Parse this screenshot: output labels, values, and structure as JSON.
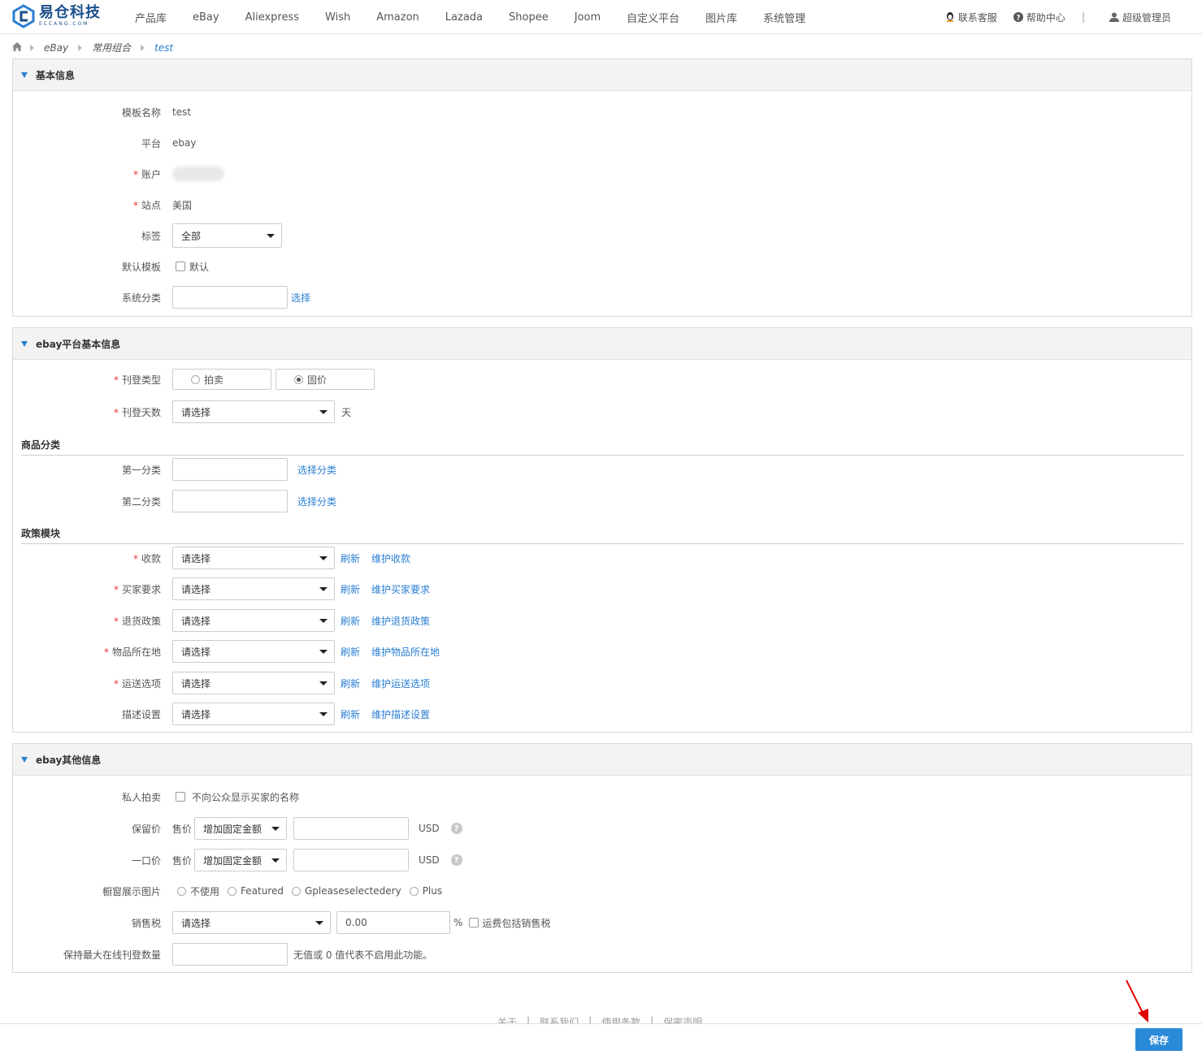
{
  "brand": {
    "name_cn": "易仓科技",
    "name_en": "ECCANG.COM",
    "color": "#1b4f8a"
  },
  "nav": [
    "产品库",
    "eBay",
    "Aliexpress",
    "Wish",
    "Amazon",
    "Lazada",
    "Shopee",
    "Joom",
    "自定义平台",
    "图片库",
    "系统管理"
  ],
  "nav_right": {
    "service": "联系客服",
    "help": "帮助中心",
    "sep": "|",
    "user": "超级管理员"
  },
  "breadcrumb": [
    "eBay",
    "常用组合",
    "test"
  ],
  "basic": {
    "title": "基本信息",
    "template_name_label": "模板名称",
    "template_name": "test",
    "platform_label": "平台",
    "platform": "ebay",
    "account_label": "账户",
    "site_label": "站点",
    "site": "美国",
    "tag_label": "标签",
    "tag_value": "全部",
    "default_label": "默认模板",
    "default_check": "默认",
    "sys_cat_label": "系统分类",
    "sys_cat_link": "选择"
  },
  "ebay_basic": {
    "title": "ebay平台基本信息",
    "listing_type_label": "刊登类型",
    "auction": "拍卖",
    "fixed": "固价",
    "listing_days_label": "刊登天数",
    "listing_days_value": "请选择",
    "days_unit": "天",
    "cat_section": "商品分类",
    "cat1_label": "第一分类",
    "cat2_label": "第二分类",
    "choose_cat": "选择分类",
    "policy_section": "政策模块",
    "refresh": "刷新",
    "policies": [
      {
        "label": "收款",
        "required": "*",
        "value": "请选择",
        "maintain": "维护收款"
      },
      {
        "label": "买家要求",
        "required": "*",
        "value": "请选择",
        "maintain": "维护买家要求"
      },
      {
        "label": "退货政策",
        "required": "*",
        "value": "请选择",
        "maintain": "维护退货政策"
      },
      {
        "label": "物品所在地",
        "required": "*",
        "value": "请选择",
        "maintain": "维护物品所在地"
      },
      {
        "label": "运送选项",
        "required": "*",
        "value": "请选择",
        "maintain": "维护运送选项"
      },
      {
        "label": "描述设置",
        "required": "",
        "value": "请选择",
        "maintain": "维护描述设置"
      }
    ]
  },
  "ebay_other": {
    "title": "ebay其他信息",
    "private_label": "私人拍卖",
    "private_check": "不向公众显示买家的名称",
    "reserve_label": "保留价",
    "price_label": "售价",
    "adjust": "增加固定金额",
    "currency": "USD",
    "bin_label": "一口价",
    "gallery_label": "橱窗展示图片",
    "gallery_opts": [
      "不使用",
      "Featured",
      "Gpleaseselectedery",
      "Plus"
    ],
    "tax_label": "销售税",
    "tax_value": "请选择",
    "tax_rate": "0.00",
    "percent": "%",
    "tax_ship": "运费包括销售税",
    "max_label": "保持最大在线刊登数量",
    "max_hint": "无值或 0 值代表不启用此功能。"
  },
  "footer": [
    "关于",
    "联系我们",
    "使用条款",
    "保密声明"
  ],
  "save": "保存",
  "colors": {
    "accent": "#2a7ed3",
    "required": "#e33333",
    "save_button": "#2a8ad8",
    "annotation_arrow": "#e00000"
  }
}
